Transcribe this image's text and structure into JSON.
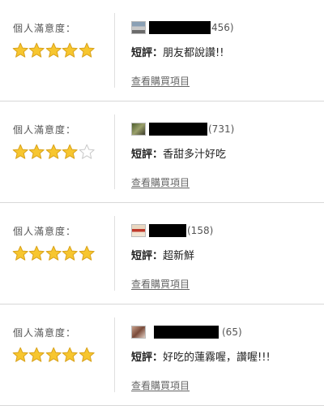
{
  "reviews": [
    {
      "satisfaction_label": "個人滿意度：",
      "rating": 5,
      "count": "456)",
      "short_label": "短評：",
      "comment": "朋友都說讚!!",
      "link_label": "查看購買項目"
    },
    {
      "satisfaction_label": "個人滿意度：",
      "rating": 4,
      "count": "(731)",
      "short_label": "短評：",
      "comment": "香甜多汁好吃",
      "link_label": "查看購買項目"
    },
    {
      "satisfaction_label": "個人滿意度：",
      "rating": 5,
      "count": "(158)",
      "short_label": "短評：",
      "comment": "超新鮮",
      "link_label": "查看購買項目"
    },
    {
      "satisfaction_label": "個人滿意度：",
      "rating": 5,
      "count": "(65)",
      "short_label": "短評：",
      "comment": "好吃的蓮霧喔，讚喔!!!",
      "link_label": "查看購買項目"
    }
  ],
  "colors": {
    "star_fill": "#f7c62f",
    "star_stroke": "#d9a21a",
    "star_empty": "#ffffff",
    "star_empty_stroke": "#c8c8c8"
  },
  "icons": {
    "filled_star": "star-filled-icon",
    "empty_star": "star-empty-icon"
  }
}
